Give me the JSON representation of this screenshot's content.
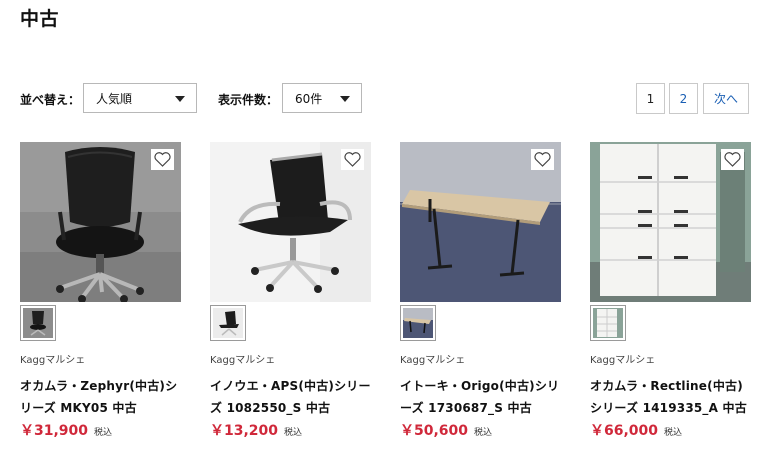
{
  "page": {
    "title": "中古"
  },
  "controls": {
    "sort_label": "並べ替え：",
    "sort_value": "人気順",
    "count_label": "表示件数：",
    "count_value": "60件"
  },
  "pagination": {
    "pages": [
      "1",
      "2"
    ],
    "next_label": "次へ",
    "current": "1"
  },
  "products": [
    {
      "shop": "Kaggマルシェ",
      "name": "オカムラ・Zephyr(中古)シリーズ MKY05 中古",
      "price": "￥31,900",
      "tax": "税込",
      "image": "mesh-chair-icon"
    },
    {
      "shop": "Kaggマルシェ",
      "name": "イノウエ・APS(中古)シリーズ 1082550_S 中古",
      "price": "￥13,200",
      "tax": "税込",
      "image": "office-chair-icon"
    },
    {
      "shop": "Kaggマルシェ",
      "name": "イトーキ・Origo(中古)シリーズ 1730687_S 中古",
      "price": "￥50,600",
      "tax": "税込",
      "image": "desk-icon"
    },
    {
      "shop": "Kaggマルシェ",
      "name": "オカムラ・Rectline(中古)シリーズ 1419335_A 中古",
      "price": "￥66,000",
      "tax": "税込",
      "image": "locker-icon"
    }
  ],
  "colors": {
    "price": "#d0283a",
    "link": "#1a5fb4"
  },
  "icons": {
    "favorite": "heart-outline-icon",
    "dropdown": "caret-down-icon"
  }
}
